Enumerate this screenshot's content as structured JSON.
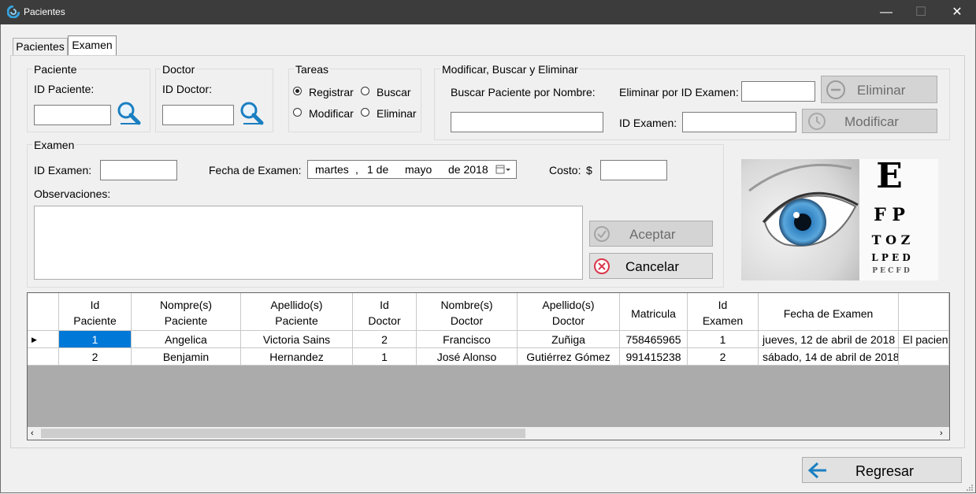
{
  "window": {
    "title": "Pacientes",
    "minimize": "—",
    "maximize": "☐",
    "close": "✕"
  },
  "tabs": [
    {
      "label": "Pacientes"
    },
    {
      "label": "Examen"
    }
  ],
  "paciente": {
    "legend": "Paciente",
    "id_label": "ID Paciente:",
    "id_value": ""
  },
  "doctor": {
    "legend": "Doctor",
    "id_label": "ID Doctor:",
    "id_value": ""
  },
  "tareas": {
    "legend": "Tareas",
    "registrar": "Registrar",
    "buscar": "Buscar",
    "modificar": "Modificar",
    "eliminar": "Eliminar",
    "selected": "Registrar"
  },
  "mbe": {
    "legend": "Modificar, Buscar y Eliminar",
    "buscar_nombre_label": "Buscar Paciente por Nombre:",
    "eliminar_id_label": "Eliminar por ID Examen:",
    "id_examen_label": "ID Examen:",
    "eliminar_button": "Eliminar",
    "modificar_button": "Modificar"
  },
  "examen": {
    "legend": "Examen",
    "id_label": "ID Examen:",
    "fecha_label": "Fecha de Examen:",
    "fecha_dia": "martes",
    "fecha_sep": ",",
    "fecha_num": "1 de",
    "fecha_mes": "mayo",
    "fecha_anio": "de 2018",
    "costo_label": "Costo:",
    "currency": "$",
    "observaciones_label": "Observaciones:",
    "aceptar_button": "Aceptar",
    "cancelar_button": "Cancelar"
  },
  "eye_chart": {
    "row1": "E",
    "row2": "F P",
    "row3": "T O Z",
    "row4": "L P E D",
    "row5": "P E C F D"
  },
  "grid": {
    "columns": [
      {
        "line1": "Id",
        "line2": "Paciente"
      },
      {
        "line1": "Nompre(s)",
        "line2": "Paciente"
      },
      {
        "line1": "Apellido(s)",
        "line2": "Paciente"
      },
      {
        "line1": "Id",
        "line2": "Doctor"
      },
      {
        "line1": "Nombre(s)",
        "line2": "Doctor"
      },
      {
        "line1": "Apellido(s)",
        "line2": "Doctor"
      },
      {
        "line1": "Matricula",
        "line2": ""
      },
      {
        "line1": "Id",
        "line2": "Examen"
      },
      {
        "line1": "Fecha de Examen",
        "line2": ""
      },
      {
        "line1": "",
        "line2": ""
      }
    ],
    "rows": [
      [
        "1",
        "Angelica",
        "Victoria Sains",
        "2",
        "Francisco",
        "Zuñiga",
        "758465965",
        "1",
        "jueves, 12 de abril de 2018",
        "El pacient"
      ],
      [
        "2",
        "Benjamin",
        "Hernandez",
        "1",
        "José Alonso",
        "Gutiérrez Gómez",
        "991415238",
        "2",
        "sábado, 14 de abril de 2018",
        ""
      ]
    ]
  },
  "regresar_button": "Regresar",
  "colors": {
    "accent": "#0078d7",
    "titlebar": "#3c3c3c",
    "icon_blue": "#1a7fc1",
    "cancel_red": "#d9364a"
  }
}
